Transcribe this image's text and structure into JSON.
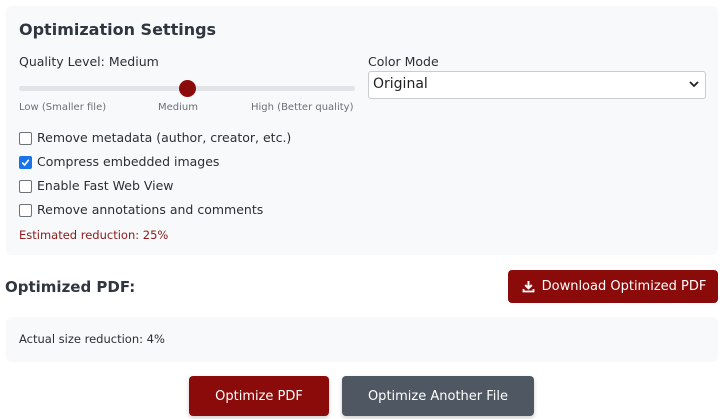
{
  "settings": {
    "title": "Optimization Settings",
    "quality": {
      "label": "Quality Level: Medium",
      "value_fraction": 0.5,
      "low_label": "Low (Smaller file)",
      "mid_label": "Medium",
      "high_label": "High (Better quality)"
    },
    "color_mode": {
      "label": "Color Mode",
      "selected": "Original"
    },
    "options": [
      {
        "label": "Remove metadata (author, creator, etc.)",
        "checked": false
      },
      {
        "label": "Compress embedded images",
        "checked": true
      },
      {
        "label": "Enable Fast Web View",
        "checked": false
      },
      {
        "label": "Remove annotations and comments",
        "checked": false
      }
    ],
    "estimate": "Estimated reduction: 25%"
  },
  "result": {
    "title": "Optimized PDF:",
    "download_label": "Download Optimized PDF",
    "reduction_text": "Actual size reduction: 4%"
  },
  "actions": {
    "optimize_label": "Optimize PDF",
    "another_label": "Optimize Another File"
  },
  "colors": {
    "accent": "#8b0a0a",
    "secondary": "#4f5762",
    "checkbox_checked": "#1a73e8"
  },
  "icons": {
    "download": "download-icon",
    "select": "chevron-down-icon",
    "check": "check-icon"
  }
}
